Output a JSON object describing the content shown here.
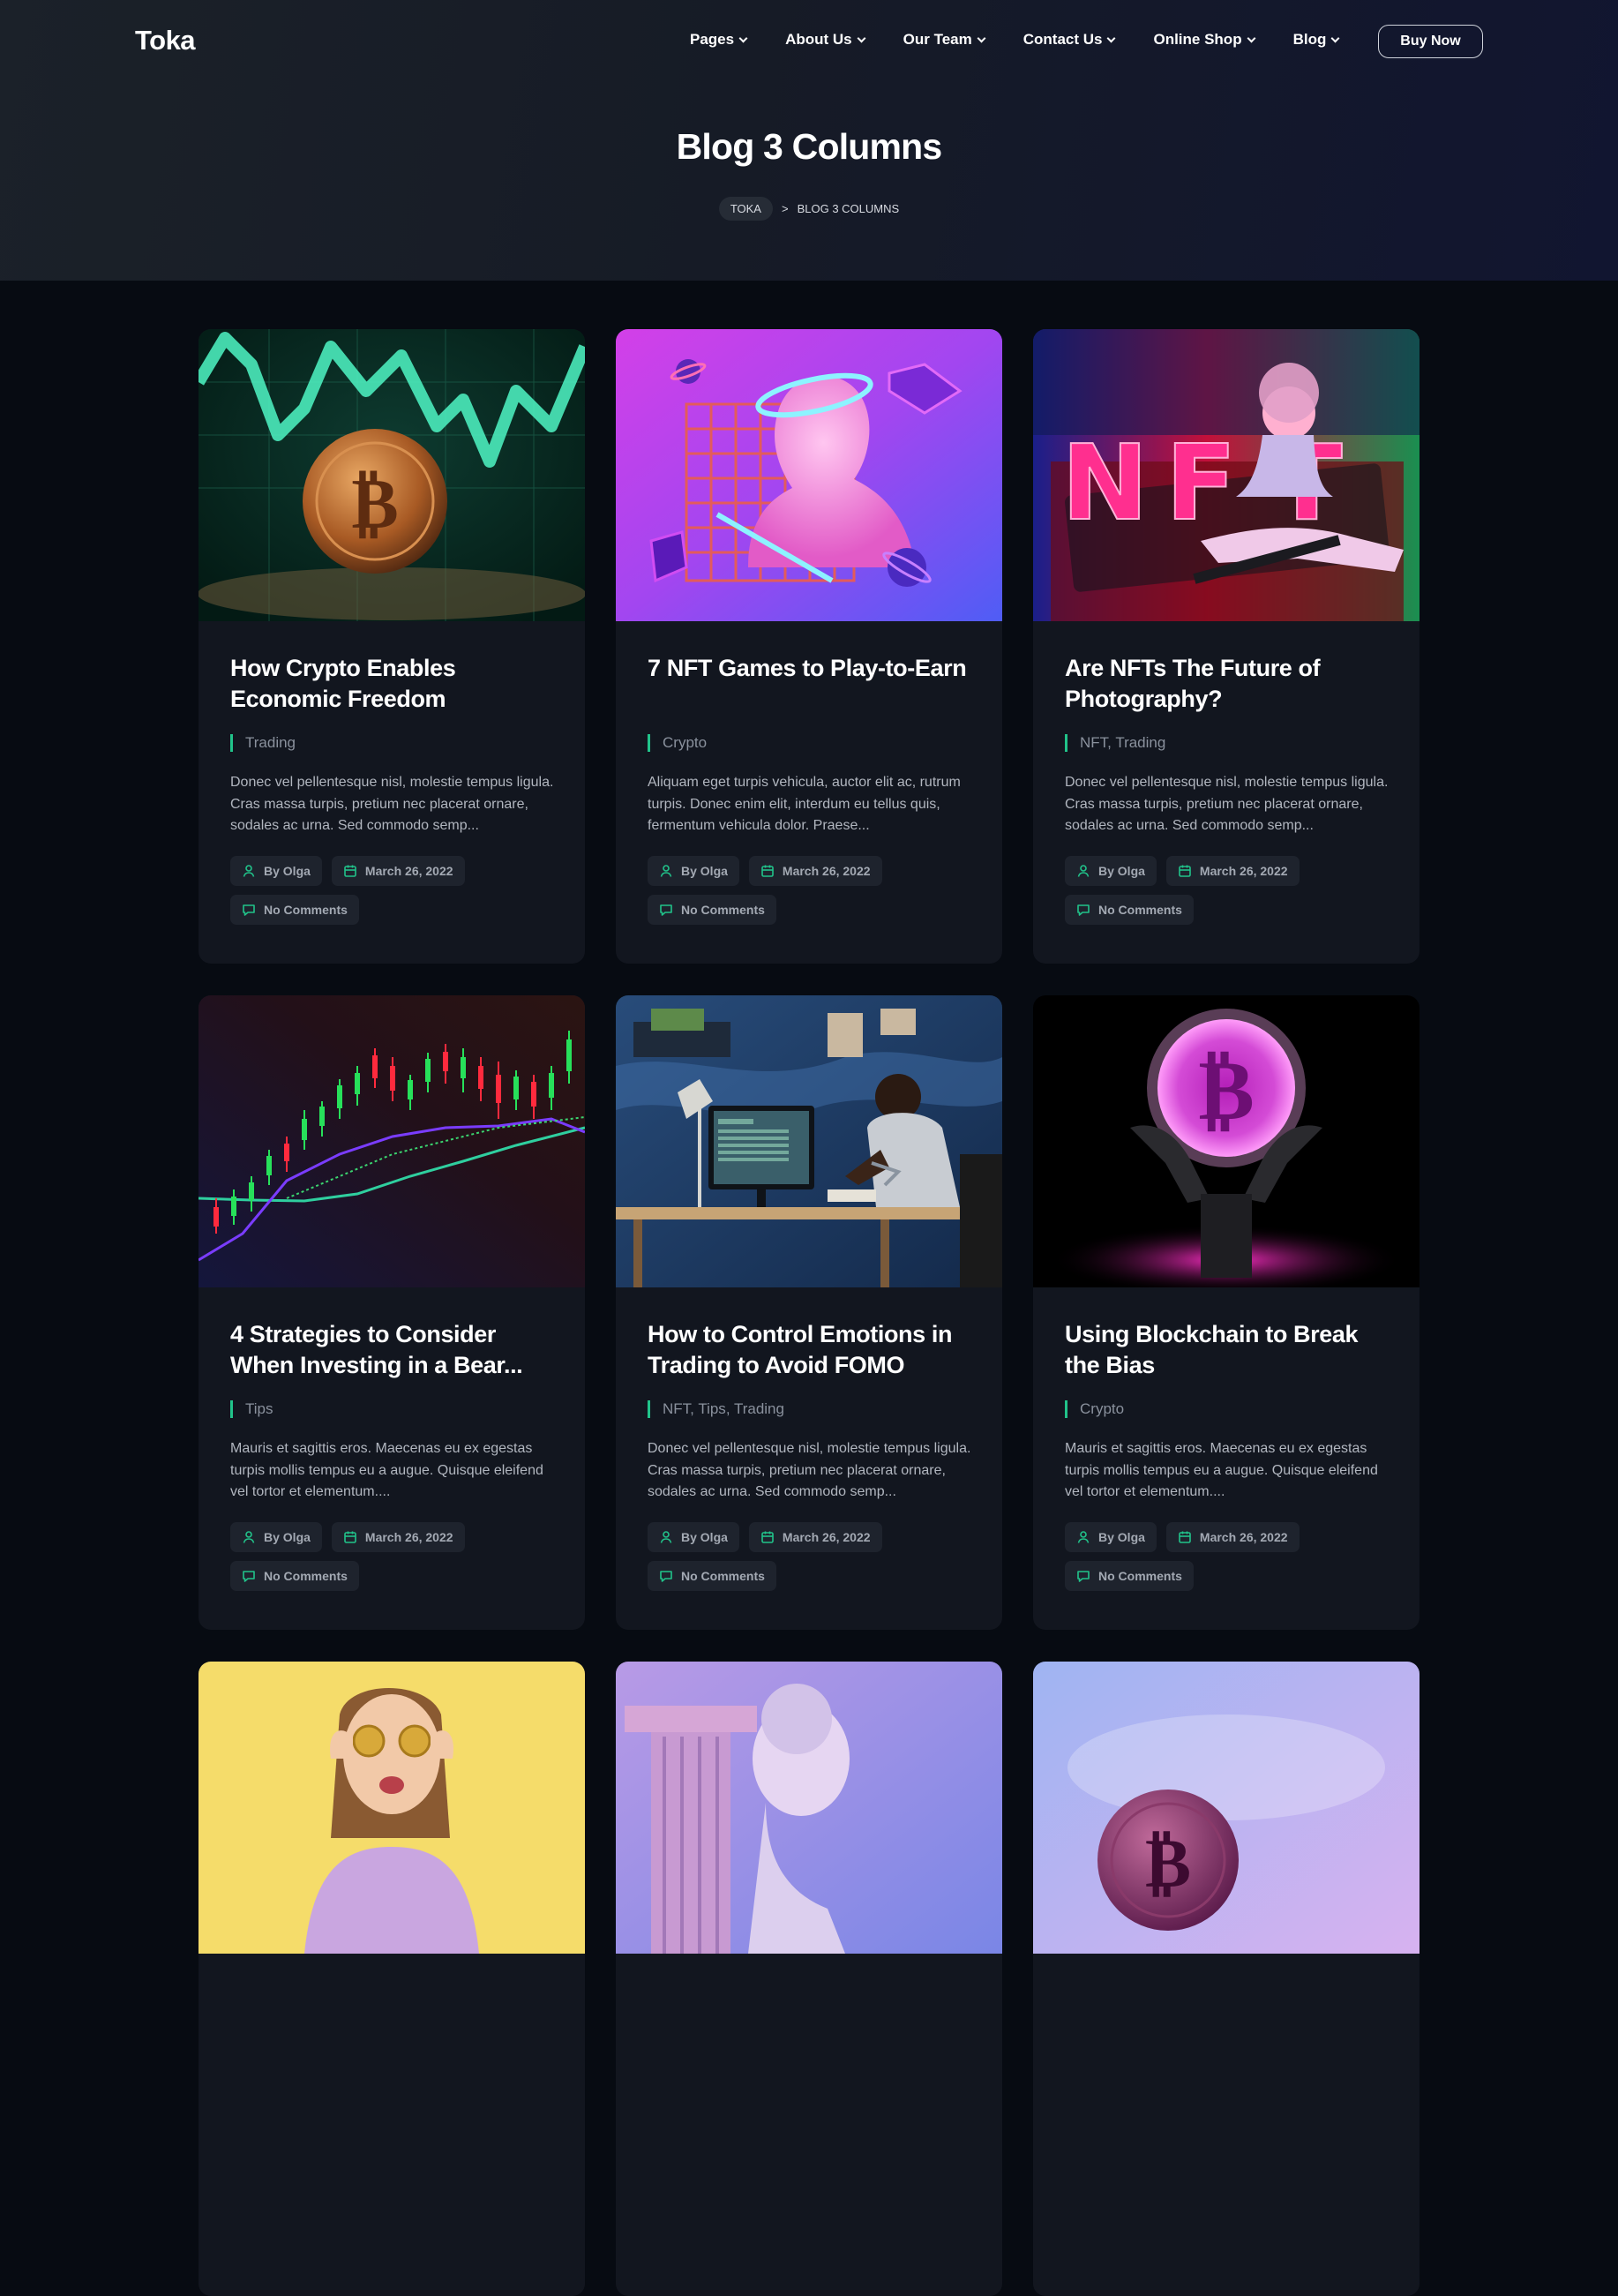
{
  "brand": {
    "logo": "Toka",
    "accent": "#21c38a"
  },
  "nav": {
    "items": [
      {
        "label": "Pages"
      },
      {
        "label": "About Us"
      },
      {
        "label": "Our Team"
      },
      {
        "label": "Contact Us"
      },
      {
        "label": "Online Shop"
      },
      {
        "label": "Blog"
      }
    ],
    "cta": "Buy Now"
  },
  "hero": {
    "title": "Blog 3 Columns",
    "breadcrumb": {
      "home": "TOKA",
      "separator": ">",
      "current": "BLOG 3 COLUMNS"
    }
  },
  "posts": [
    {
      "title": "How Crypto Enables Economic Freedom",
      "categories": [
        "Trading"
      ],
      "excerpt": "Donec vel pellentesque nisl, molestie tempus ligula. Cras massa turpis, pretium nec placerat ornare, sodales ac urna. Sed commodo semp...",
      "author": "By Olga",
      "date": "March 26, 2022",
      "comments": "No Comments",
      "image": "bitcoin-coin-green-chart"
    },
    {
      "title": "7 NFT Games to Play-to-Earn",
      "categories": [
        "Crypto"
      ],
      "excerpt": "Aliquam eget turpis vehicula, auctor elit ac, rutrum turpis. Donec enim elit, interdum eu tellus quis, fermentum vehicula dolor. Praese...",
      "author": "By Olga",
      "date": "March 26, 2022",
      "comments": "No Comments",
      "image": "pink-statue-bust-grid"
    },
    {
      "title": "Are NFTs The Future of Photography?",
      "categories": [
        "NFT",
        "Trading"
      ],
      "excerpt": "Donec vel pellentesque nisl, molestie tempus ligula. Cras massa turpis, pretium nec placerat ornare, sodales ac urna. Sed commodo semp...",
      "author": "By Olga",
      "date": "March 26, 2022",
      "comments": "No Comments",
      "image": "nft-letters-statue"
    },
    {
      "title": "4 Strategies to Consider When Investing in a Bear...",
      "categories": [
        "Tips"
      ],
      "excerpt": "Mauris et sagittis eros. Maecenas eu ex egestas turpis mollis tempus eu a augue. Quisque eleifend vel tortor et elementum....",
      "author": "By Olga",
      "date": "March 26, 2022",
      "comments": "No Comments",
      "image": "candlestick-chart"
    },
    {
      "title": "How to Control Emotions in Trading to Avoid FOMO",
      "categories": [
        "NFT",
        "Tips",
        "Trading"
      ],
      "excerpt": "Donec vel pellentesque nisl, molestie tempus ligula. Cras massa turpis, pretium nec placerat ornare, sodales ac urna. Sed commodo semp...",
      "author": "By Olga",
      "date": "March 26, 2022",
      "comments": "No Comments",
      "image": "trader-at-desk"
    },
    {
      "title": "Using Blockchain to Break the Bias",
      "categories": [
        "Crypto"
      ],
      "excerpt": "Mauris et sagittis eros. Maecenas eu ex egestas turpis mollis tempus eu a augue. Quisque eleifend vel tortor et elementum....",
      "author": "By Olga",
      "date": "March 26, 2022",
      "comments": "No Comments",
      "image": "hands-holding-neon-bitcoin"
    },
    {
      "image": "woman-with-coins-yellow"
    },
    {
      "image": "column-and-statue-purple"
    },
    {
      "image": "bitcoin-coin-lilac"
    }
  ]
}
